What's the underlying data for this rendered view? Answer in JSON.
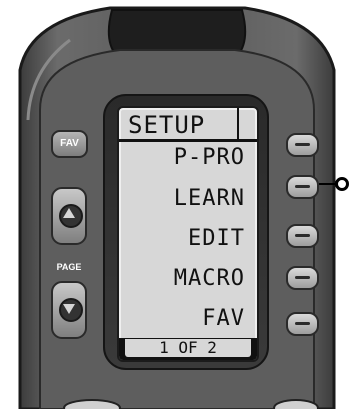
{
  "left_panel": {
    "fav_label": "FAV",
    "page_label": "PAGE",
    "page_up_icon": "triangle-up-icon",
    "page_down_icon": "triangle-down-icon"
  },
  "lcd": {
    "title": "SETUP",
    "items": [
      "P-PRO",
      "LEARN",
      "EDIT",
      "MACRO",
      "FAV"
    ],
    "footer": "1 OF 2"
  },
  "side_buttons_icon": "dash-icon",
  "colors": {
    "body_dark": "#4a4a4a",
    "body_light": "#6b6b6b",
    "lcd_bg": "#d7d7d7",
    "button_light": "#d9d9d9"
  }
}
